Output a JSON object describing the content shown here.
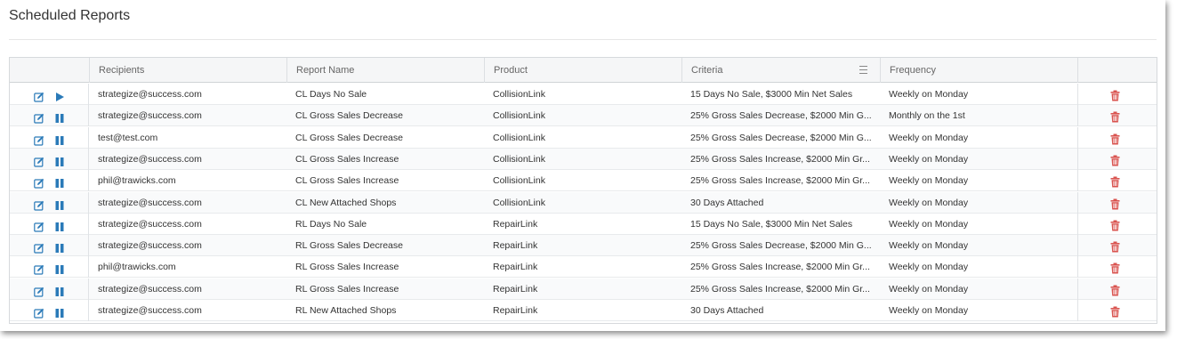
{
  "page": {
    "title": "Scheduled Reports"
  },
  "colors": {
    "accent": "#2a7ab8",
    "delete": "#d9534f",
    "header_bg": "#f5f6f7"
  },
  "table": {
    "columns": [
      "",
      "Recipients",
      "Report Name",
      "Product",
      "Criteria",
      "Frequency",
      ""
    ],
    "rows": [
      {
        "state": "paused-play",
        "state_icon": "play-icon",
        "recipients": "strategize@success.com",
        "report_name": "CL Days No Sale",
        "product": "CollisionLink",
        "criteria": "15 Days No Sale, $3000 Min Net Sales",
        "frequency": "Weekly on Monday"
      },
      {
        "state": "active",
        "state_icon": "pause-icon",
        "recipients": "strategize@success.com",
        "report_name": "CL Gross Sales Decrease",
        "product": "CollisionLink",
        "criteria": "25% Gross Sales Decrease, $2000 Min G...",
        "frequency": "Monthly on the 1st"
      },
      {
        "state": "active",
        "state_icon": "pause-icon",
        "recipients": "test@test.com",
        "report_name": "CL Gross Sales Decrease",
        "product": "CollisionLink",
        "criteria": "25% Gross Sales Decrease, $2000 Min G...",
        "frequency": "Weekly on Monday"
      },
      {
        "state": "active",
        "state_icon": "pause-icon",
        "recipients": "strategize@success.com",
        "report_name": "CL Gross Sales Increase",
        "product": "CollisionLink",
        "criteria": "25% Gross Sales Increase, $2000 Min Gr...",
        "frequency": "Weekly on Monday"
      },
      {
        "state": "active",
        "state_icon": "pause-icon",
        "recipients": "phil@trawicks.com",
        "report_name": "CL Gross Sales Increase",
        "product": "CollisionLink",
        "criteria": "25% Gross Sales Increase, $2000 Min Gr...",
        "frequency": "Weekly on Monday"
      },
      {
        "state": "active",
        "state_icon": "pause-icon",
        "recipients": "strategize@success.com",
        "report_name": "CL New Attached Shops",
        "product": "CollisionLink",
        "criteria": "30 Days Attached",
        "frequency": "Weekly on Monday"
      },
      {
        "state": "active",
        "state_icon": "pause-icon",
        "recipients": "strategize@success.com",
        "report_name": "RL Days No Sale",
        "product": "RepairLink",
        "criteria": "15 Days No Sale, $3000 Min Net Sales",
        "frequency": "Weekly on Monday"
      },
      {
        "state": "active",
        "state_icon": "pause-icon",
        "recipients": "strategize@success.com",
        "report_name": "RL Gross Sales Decrease",
        "product": "RepairLink",
        "criteria": "25% Gross Sales Decrease, $2000 Min G...",
        "frequency": "Weekly on Monday"
      },
      {
        "state": "active",
        "state_icon": "pause-icon",
        "recipients": "phil@trawicks.com",
        "report_name": "RL Gross Sales Increase",
        "product": "RepairLink",
        "criteria": "25% Gross Sales Increase, $2000 Min Gr...",
        "frequency": "Weekly on Monday"
      },
      {
        "state": "active",
        "state_icon": "pause-icon",
        "recipients": "strategize@success.com",
        "report_name": "RL Gross Sales Increase",
        "product": "RepairLink",
        "criteria": "25% Gross Sales Increase, $2000 Min Gr...",
        "frequency": "Weekly on Monday"
      },
      {
        "state": "active",
        "state_icon": "pause-icon",
        "recipients": "strategize@success.com",
        "report_name": "RL New Attached Shops",
        "product": "RepairLink",
        "criteria": "30 Days Attached",
        "frequency": "Weekly on Monday"
      }
    ]
  }
}
